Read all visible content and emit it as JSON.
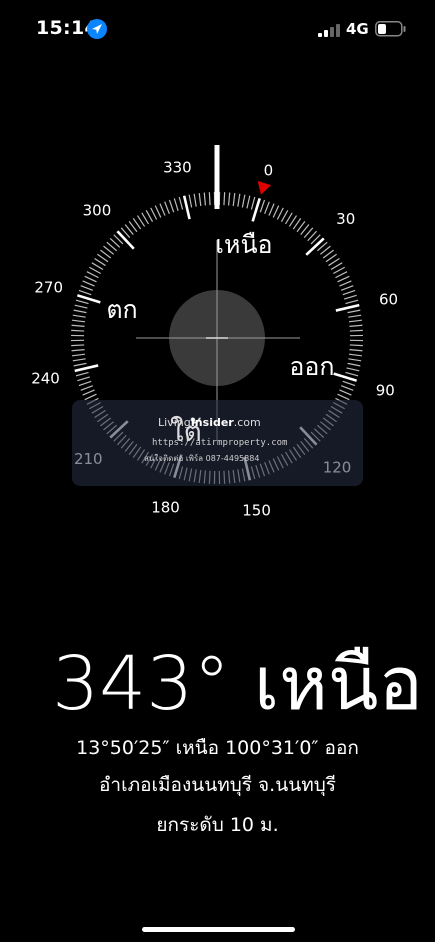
{
  "status_bar": {
    "time": "15:14",
    "network": "4G",
    "location_icon": "location-arrow-icon",
    "signal_icon": "cellular-signal-icon",
    "battery_icon": "battery-icon",
    "accent_color": "#0a84ff"
  },
  "compass": {
    "heading_degrees": 343,
    "degree_labels": [
      "0",
      "30",
      "60",
      "90",
      "120",
      "150",
      "180",
      "210",
      "240",
      "270",
      "300",
      "330"
    ],
    "cardinal": {
      "north": "เหนือ",
      "east": "ออก",
      "west": "ตก"
    },
    "marker_color": "#e00000"
  },
  "watermark": {
    "logo_light": "Living",
    "logo_bold": "Insider",
    "logo_suffix": ".com",
    "overlay_text": "ใต้",
    "url": "https://atirmproperty.com",
    "contact": "สนใจติดต่อ เพิร์ล 087-4495884"
  },
  "readout": {
    "heading_text": "343° เหนือ",
    "coordinates": "13°50′25″ เหนือ  100°31′0″ ออก",
    "location": "อำเภอเมืองนนทบุรี จ.นนทบุรี",
    "elevation": "ยกระดับ 10 ม."
  }
}
